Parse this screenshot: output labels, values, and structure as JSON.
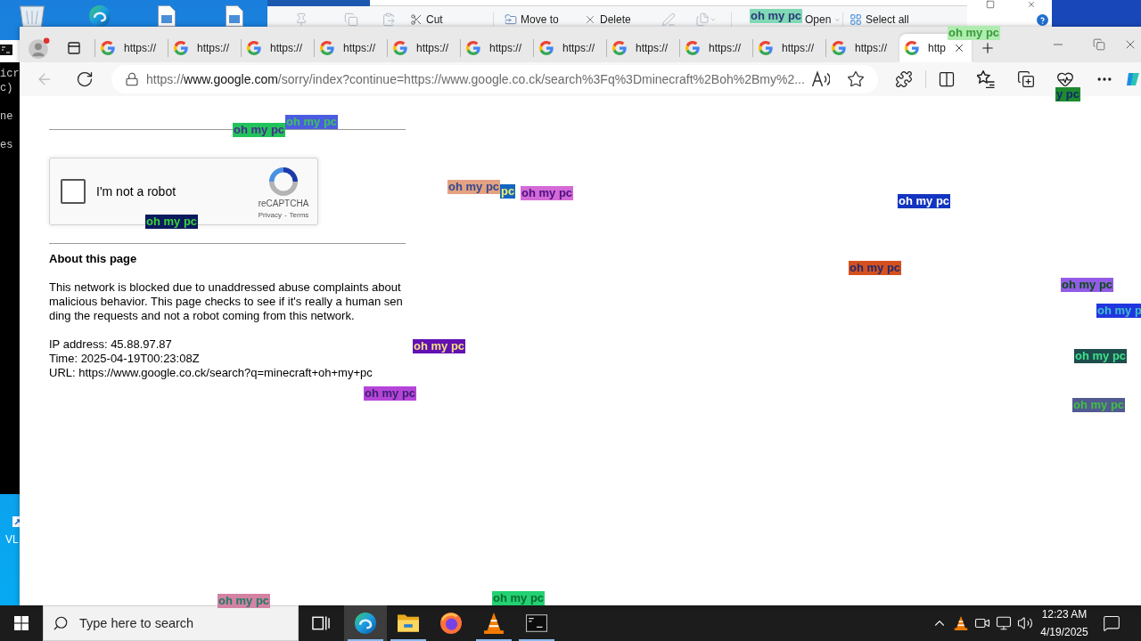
{
  "desktop": {
    "shortcut_label": "VL"
  },
  "console_window": {
    "lines": [
      "icr",
      "c)",
      "ne",
      "es"
    ]
  },
  "explorer_ribbon": {
    "items": [
      {
        "kind": "cut",
        "label": "Cut"
      },
      {
        "kind": "move",
        "label": "Move to"
      },
      {
        "kind": "delete",
        "label": "Delete"
      },
      {
        "kind": "open",
        "label": "Open"
      },
      {
        "kind": "select-all",
        "label": "Select all"
      }
    ]
  },
  "browser": {
    "tabs": [
      {
        "title": "https://",
        "selected": false
      },
      {
        "title": "https://",
        "selected": false
      },
      {
        "title": "https://",
        "selected": false
      },
      {
        "title": "https://",
        "selected": false
      },
      {
        "title": "https://",
        "selected": false
      },
      {
        "title": "https://",
        "selected": false
      },
      {
        "title": "https://",
        "selected": false
      },
      {
        "title": "https://",
        "selected": false
      },
      {
        "title": "https://",
        "selected": false
      },
      {
        "title": "https://",
        "selected": false
      },
      {
        "title": "https://",
        "selected": false
      },
      {
        "title": "http",
        "selected": true
      }
    ],
    "back_disabled": true,
    "address": [
      {
        "text": "https://",
        "emphasis": false
      },
      {
        "text": "www.google.com",
        "emphasis": true
      },
      {
        "text": "/sorry/index?continue=https://www.google.co.ck/search%3Fq%3Dminecraft%2Boh%2Bmy%2...",
        "emphasis": false
      }
    ]
  },
  "page": {
    "recaptcha": {
      "checkbox_label": "I'm not a robot",
      "checked": false,
      "brand": "reCAPTCHA",
      "links": [
        "Privacy",
        "Terms"
      ],
      "separator": "-"
    },
    "heading": "About this page",
    "paragraph": "This network is blocked due to unaddressed abuse complaints about malicious behavior. This page checks to see if it's really a human sending the requests and not a robot coming from this network.",
    "details": [
      "IP address: 45.88.97.87",
      "Time: 2025-04-19T00:23:08Z",
      "URL: https://www.google.co.ck/search?q=minecraft+oh+my+pc"
    ]
  },
  "taskbar": {
    "search": {
      "placeholder": "Type here to search"
    },
    "apps": [
      {
        "kind": "edge",
        "selected": true,
        "running": true
      },
      {
        "kind": "explorer",
        "selected": false,
        "running": true
      },
      {
        "kind": "firefox",
        "selected": false,
        "running": false
      },
      {
        "kind": "vlc",
        "selected": false,
        "running": true
      },
      {
        "kind": "terminal",
        "selected": false,
        "running": true
      }
    ],
    "clock": {
      "time": "12:23 AM",
      "date": "4/19/2025"
    }
  },
  "overlays": [
    {
      "text": "oh my pc",
      "color": "#80d8b4"
    },
    {
      "text": "oh my pc",
      "color": "#b0ecb0"
    },
    {
      "text": "y pc",
      "color": "#1f8a2f"
    },
    {
      "text": "oh my pc",
      "color": "#4b5ce0"
    },
    {
      "text": "oh my pc",
      "color": "#22c35a"
    },
    {
      "text": "oh my pc",
      "color": "#e3a282"
    },
    {
      "text": "pc",
      "color": "#1565c0"
    },
    {
      "text": "oh my pc",
      "color": "#d46ad6"
    },
    {
      "text": "oh my pc",
      "color": "#1234c0"
    },
    {
      "text": "oh my pc",
      "color": "#0b1a5c"
    },
    {
      "text": "oh my pc",
      "color": "#d4511f"
    },
    {
      "text": "oh my pc",
      "color": "#935ce6"
    },
    {
      "text": "oh my p",
      "color": "#2236e0"
    },
    {
      "text": "oh my pc",
      "color": "#6210b4"
    },
    {
      "text": "oh my pc",
      "color": "#1d4d4d"
    },
    {
      "text": "oh my pc",
      "color": "#b545d8"
    },
    {
      "text": "oh my pc",
      "color": "#525a92"
    },
    {
      "text": "oh my pc",
      "color": "#22d172"
    },
    {
      "text": "oh my pc",
      "color": "#d482a4"
    }
  ]
}
